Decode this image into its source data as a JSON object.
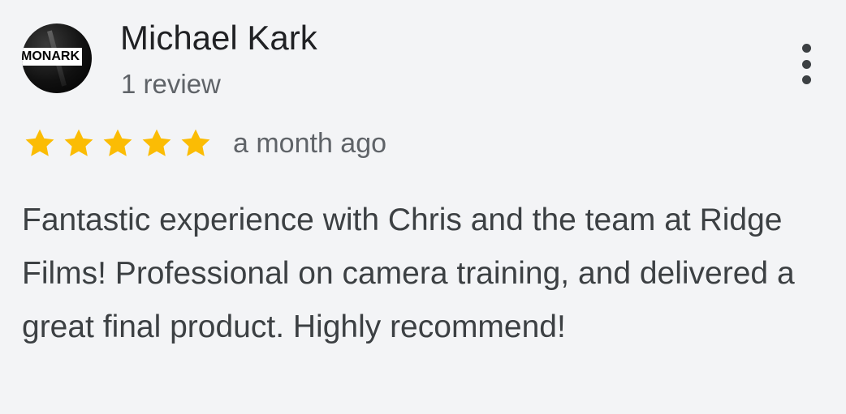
{
  "reviewer": {
    "avatar_logo_text": "MONARK",
    "name": "Michael Kark",
    "review_count": "1 review"
  },
  "review": {
    "rating": 5,
    "rating_max": 5,
    "date": "a month ago",
    "text": "Fantastic experience with Chris and the team at Ridge Films! Professional on camera training, and delivered a great final product. Highly recommend!"
  },
  "icons": {
    "star": "star-icon",
    "more": "more-vertical-icon"
  },
  "colors": {
    "background": "#f3f4f6",
    "star": "#fbbc04",
    "name": "#202124",
    "secondary_text": "#5f6368",
    "body_text": "#3c4043"
  }
}
